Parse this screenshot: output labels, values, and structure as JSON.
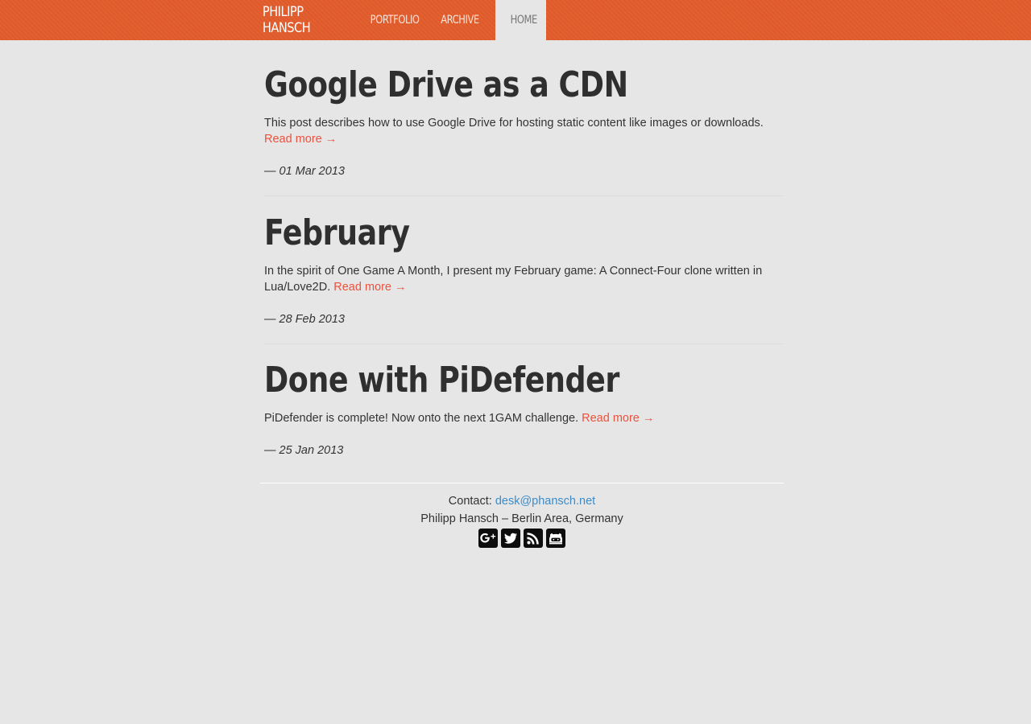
{
  "nav": {
    "brand": "PHILIPP HANSCH",
    "items": [
      {
        "label": "PORTFOLIO"
      },
      {
        "label": "ARCHIVE"
      },
      {
        "label": "HOME"
      }
    ]
  },
  "posts": [
    {
      "title": "Google Drive as a CDN",
      "excerpt": "This post describes how to use Google Drive for hosting static content like images or downloads.",
      "read_more": "Read more →",
      "date": "— 01 Mar 2013"
    },
    {
      "title": "February",
      "excerpt": "In the spirit of One Game A Month, I present my February game: A Connect-Four clone written in Lua/Love2D.",
      "read_more": "Read more →",
      "date": "— 28 Feb 2013"
    },
    {
      "title": "Done with PiDefender",
      "excerpt": "PiDefender is complete! Now onto the next 1GAM challenge.",
      "read_more": "Read more →",
      "date": "— 25 Jan 2013"
    }
  ],
  "footer": {
    "contact_label": "Contact:",
    "email": "desk@phansch.net",
    "location": "Philipp Hansch – Berlin Area, Germany",
    "social_icons": [
      "google-plus-icon",
      "twitter-icon",
      "rss-icon",
      "github-icon"
    ]
  },
  "colors": {
    "navbar": "#e25c2c",
    "background": "#e6e6e6",
    "link": "#e8533f",
    "email_link": "#3d8cc9"
  }
}
